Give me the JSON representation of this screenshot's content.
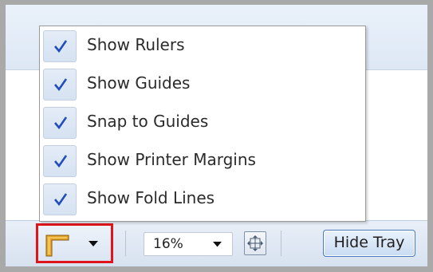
{
  "menu": {
    "items": [
      {
        "label": "Show Rulers",
        "checked": true
      },
      {
        "label": "Show Guides",
        "checked": true
      },
      {
        "label": "Snap to Guides",
        "checked": true
      },
      {
        "label": "Show Printer Margins",
        "checked": true
      },
      {
        "label": "Show Fold Lines",
        "checked": true
      }
    ]
  },
  "tray": {
    "ruler_button_icon": "ruler-corner-icon",
    "zoom_value": "16%",
    "fit_icon": "fit-page-icon",
    "hide_tray_label": "Hide Tray"
  },
  "colors": {
    "check": "#1f4fbf",
    "highlight_border": "#e0141b",
    "ruler": "#d89a1e"
  }
}
